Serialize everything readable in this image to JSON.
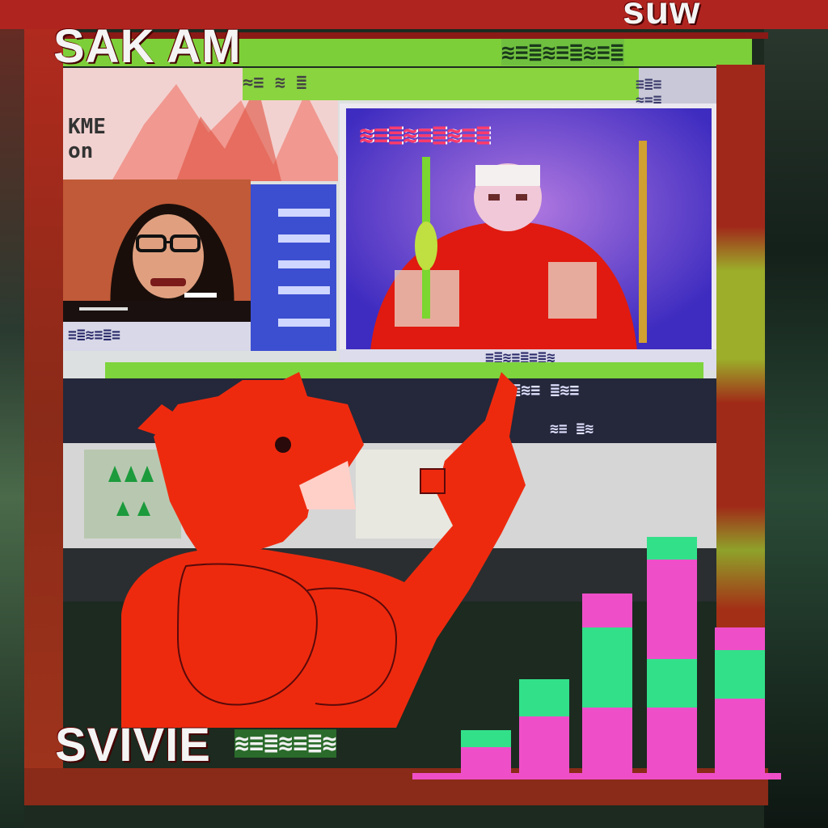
{
  "labels": {
    "top_left": "SAK AM",
    "top_right": "suw",
    "bottom_left": "SVIVIE"
  },
  "colors": {
    "frame_red": "#c0201a",
    "screen_purple": "#5a3ec8",
    "bar_magenta": "#ee4fc8",
    "bar_green": "#33e08a",
    "dog_red": "#ee2a0e",
    "neon_green": "#8adf3a"
  },
  "bars": [
    {
      "segments": [
        {
          "color": "magenta",
          "value": 0.18
        },
        {
          "color": "green",
          "value": 0.12
        }
      ]
    },
    {
      "segments": [
        {
          "color": "magenta",
          "value": 0.4
        },
        {
          "color": "green",
          "value": 0.26
        }
      ]
    },
    {
      "segments": [
        {
          "color": "magenta",
          "value": 0.46
        },
        {
          "color": "green",
          "value": 0.56
        },
        {
          "color": "magenta",
          "value": 0.24
        }
      ]
    },
    {
      "segments": [
        {
          "color": "magenta",
          "value": 0.46
        },
        {
          "color": "green",
          "value": 0.34
        },
        {
          "color": "magenta",
          "value": 0.7
        },
        {
          "color": "green",
          "value": 0.16
        }
      ]
    },
    {
      "segments": [
        {
          "color": "magenta",
          "value": 0.52
        },
        {
          "color": "green",
          "value": 0.34
        },
        {
          "color": "magenta",
          "value": 0.16
        }
      ]
    }
  ]
}
